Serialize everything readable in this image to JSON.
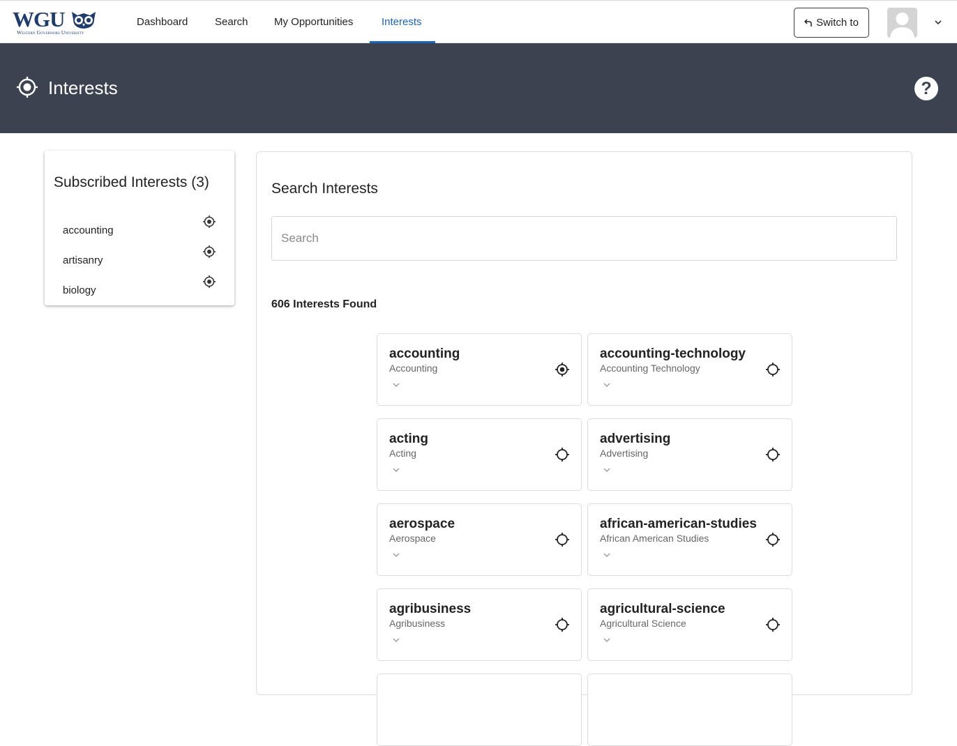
{
  "logo": {
    "main": "WGU",
    "sub": "Western Governors University"
  },
  "nav": {
    "items": [
      {
        "label": "Dashboard"
      },
      {
        "label": "Search"
      },
      {
        "label": "My Opportunities"
      },
      {
        "label": "Interests",
        "active": true
      }
    ],
    "switch_label": "Switch to",
    "switch_icon": "return-arrow-icon",
    "avatar_icon": "user-avatar-icon",
    "menu_icon": "chevron-down-icon"
  },
  "banner": {
    "title": "Interests",
    "icon": "target-icon",
    "help": "?"
  },
  "subscribed": {
    "title": "Subscribed Interests (3)",
    "items": [
      {
        "label": "accounting"
      },
      {
        "label": "artisanry"
      },
      {
        "label": "biology"
      }
    ]
  },
  "search": {
    "title": "Search Interests",
    "placeholder": "Search",
    "value": "",
    "found": "606 Interests Found"
  },
  "results": [
    {
      "name": "accounting",
      "label": "Accounting",
      "subscribed": true
    },
    {
      "name": "accounting-technology",
      "label": "Accounting Technology",
      "subscribed": false
    },
    {
      "name": "acting",
      "label": "Acting",
      "subscribed": false
    },
    {
      "name": "advertising",
      "label": "Advertising",
      "subscribed": false
    },
    {
      "name": "aerospace",
      "label": "Aerospace",
      "subscribed": false
    },
    {
      "name": "african-american-studies",
      "label": "African American Studies",
      "subscribed": false
    },
    {
      "name": "agribusiness",
      "label": "Agribusiness",
      "subscribed": false
    },
    {
      "name": "agricultural-science",
      "label": "Agricultural Science",
      "subscribed": false
    }
  ],
  "colors": {
    "brand": "#1f3c6e",
    "accent": "#1a66b8",
    "banner": "#3d4251"
  }
}
